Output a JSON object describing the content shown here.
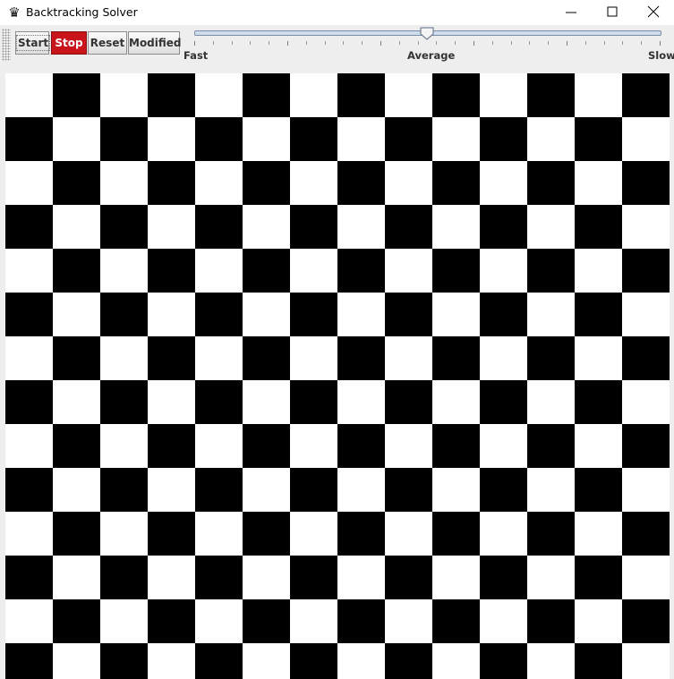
{
  "window": {
    "title": "Backtracking Solver",
    "icon": "queen-icon",
    "controls": [
      "minimize-icon",
      "maximize-icon",
      "close-icon"
    ]
  },
  "toolbar": {
    "buttons": {
      "start": "Start",
      "stop": "Stop",
      "reset": "Reset",
      "modified": "Modified"
    },
    "speed_slider": {
      "labels": {
        "fast": "Fast",
        "average": "Average",
        "slow": "Slow"
      },
      "value_fraction": 0.5
    }
  },
  "board": {
    "columns": 14,
    "rows": 14,
    "dark_color": "#000000",
    "light_color": "#ffffff",
    "top_left": "light"
  },
  "colors": {
    "stop_button": "#c8141a",
    "window_background": "#eeeeee"
  }
}
